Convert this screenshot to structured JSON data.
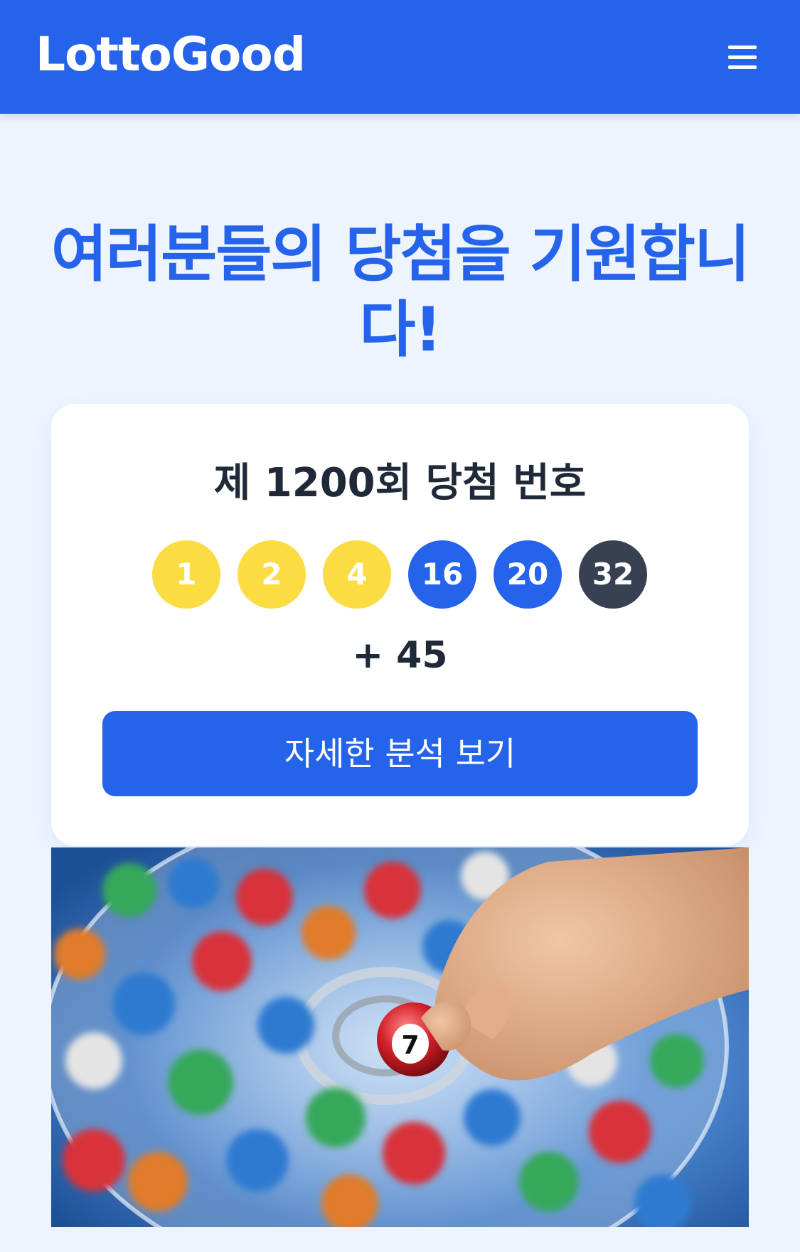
{
  "navbar": {
    "brand": "LottoGood",
    "menu_icon": "hamburger-menu-icon"
  },
  "hero": {
    "headline": "여러분들의 당첨을 기원합니다!"
  },
  "result_card": {
    "title": "제 1200회 당첨 번호",
    "numbers": [
      {
        "value": "1",
        "color": "#fbdc43"
      },
      {
        "value": "2",
        "color": "#fbdc43"
      },
      {
        "value": "4",
        "color": "#fbdc43"
      },
      {
        "value": "16",
        "color": "#2563eb"
      },
      {
        "value": "20",
        "color": "#2563eb"
      },
      {
        "value": "32",
        "color": "#374151"
      }
    ],
    "bonus": "+ 45",
    "detail_button": "자세한 분석 보기"
  },
  "image": {
    "alt": "lotto-ball-draw-image",
    "ball_number": "7"
  },
  "colors": {
    "brand_blue": "#2563eb",
    "page_background": "#eef4fe",
    "yellow_ball": "#fbdc43",
    "dark_ball": "#374151",
    "text_dark": "#1f2937"
  }
}
